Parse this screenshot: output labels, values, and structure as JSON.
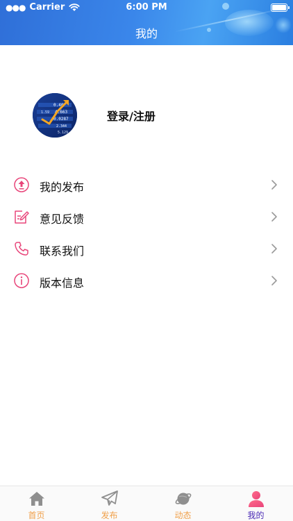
{
  "status_bar": {
    "carrier": "Carrier",
    "time": "6:00 PM"
  },
  "header": {
    "title": "我的"
  },
  "profile": {
    "login_label": "登录/注册"
  },
  "menu": {
    "items": [
      {
        "label": "我的发布",
        "icon": "upload-circle-icon"
      },
      {
        "label": "意见反馈",
        "icon": "feedback-edit-icon"
      },
      {
        "label": "联系我们",
        "icon": "phone-icon"
      },
      {
        "label": "版本信息",
        "icon": "info-circle-icon"
      }
    ]
  },
  "tabbar": {
    "tabs": [
      {
        "label": "首页",
        "icon": "home-icon",
        "active": false
      },
      {
        "label": "发布",
        "icon": "paper-plane-icon",
        "active": false
      },
      {
        "label": "动态",
        "icon": "planet-icon",
        "active": false
      },
      {
        "label": "我的",
        "icon": "person-icon",
        "active": true
      }
    ]
  },
  "colors": {
    "header_blue": "#3a86ea",
    "accent_pink": "#e8457a",
    "tab_inactive": "#f0a04a",
    "tab_active": "#4a2ab4"
  }
}
